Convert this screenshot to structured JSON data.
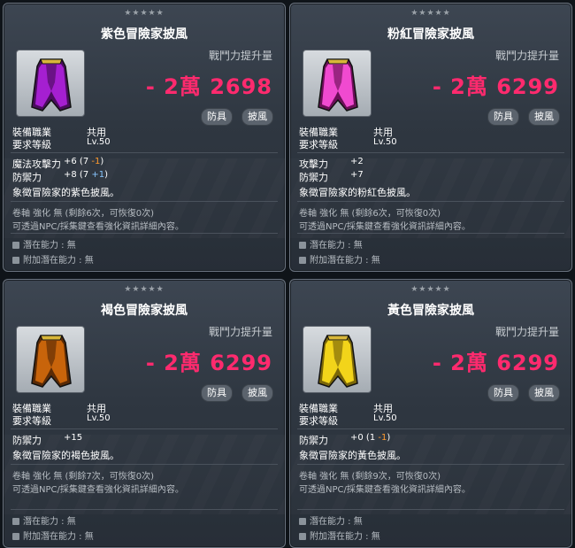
{
  "stars": "★★★★★",
  "common": {
    "compare_label": "戰鬥力提升量",
    "tags": [
      "防具",
      "披風"
    ],
    "job_label": "裝備職業",
    "job_value": "共用",
    "level_label": "要求等級",
    "level_value": "Lv.50",
    "scroll_line": "卷軸 強化 無 (剩餘{n}次，可恢復0次)",
    "guide_line": "可透過NPC/採集鍵查看強化資訊詳細內容。",
    "potential_label": "潛在能力 : 無",
    "bonus_potential_label": "附加潛在能力 : 無"
  },
  "cards": [
    {
      "name": "紫色冒險家披風",
      "compare_value": "- 2萬 2698",
      "cape_color": "#a51fd1",
      "cape_dark": "#4a0c5e",
      "stats": [
        {
          "label": "魔法攻擊力",
          "total": "+6",
          "base": "7",
          "mod": "-1",
          "mod_sign": "minus"
        },
        {
          "label": "防禦力",
          "total": "+8",
          "base": "7",
          "mod": "+1",
          "mod_sign": "plus"
        }
      ],
      "description": "象徵冒險家的紫色披風。",
      "scroll_line": "卷軸 強化 無 (剩餘6次，可恢復0次)"
    },
    {
      "name": "粉紅冒險家披風",
      "compare_value": "- 2萬 6299",
      "cape_color": "#f04ad0",
      "cape_dark": "#6b0f58",
      "stats": [
        {
          "label": "攻擊力",
          "total": "+2",
          "base": "",
          "mod": "",
          "mod_sign": ""
        },
        {
          "label": "防禦力",
          "total": "+7",
          "base": "",
          "mod": "",
          "mod_sign": ""
        }
      ],
      "description": "象徵冒險家的粉紅色披風。",
      "scroll_line": "卷軸 強化 無 (剩餘6次，可恢復0次)"
    },
    {
      "name": "褐色冒險家披風",
      "compare_value": "- 2萬 6299",
      "cape_color": "#c8640b",
      "cape_dark": "#5a2a05",
      "stats": [
        {
          "label": "防禦力",
          "total": "+15",
          "base": "",
          "mod": "",
          "mod_sign": ""
        }
      ],
      "description": "象徵冒險家的褐色披風。",
      "scroll_line": "卷軸 強化 無 (剩餘7次，可恢復0次)"
    },
    {
      "name": "黃色冒險家披風",
      "compare_value": "- 2萬 6299",
      "cape_color": "#f2d41a",
      "cape_dark": "#7a6608",
      "stats": [
        {
          "label": "防禦力",
          "total": "+0",
          "base": "1",
          "mod": "-1",
          "mod_sign": "minus"
        }
      ],
      "description": "象徵冒險家的黃色披風。",
      "scroll_line": "卷軸 強化 無 (剩餘9次，可恢復0次)"
    }
  ]
}
